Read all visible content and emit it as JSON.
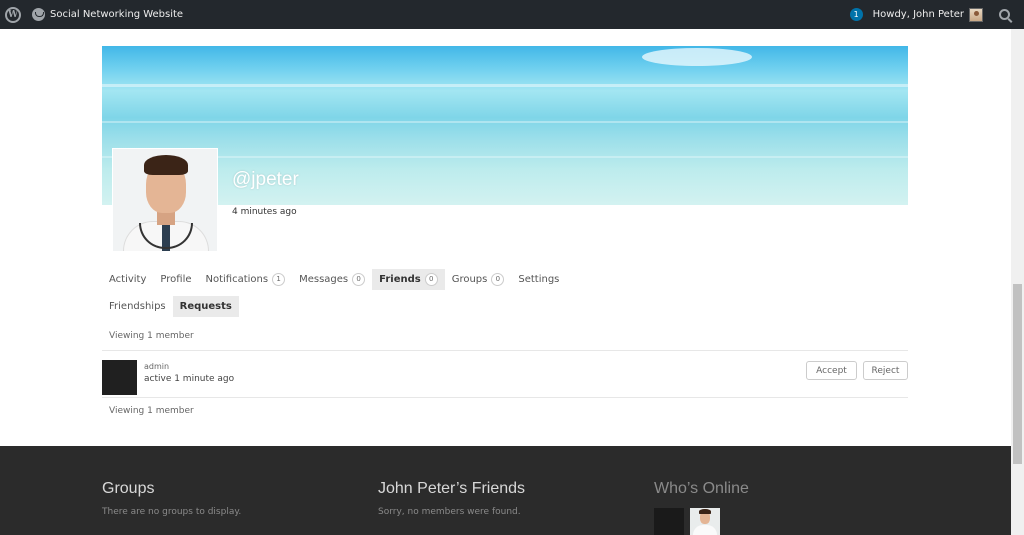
{
  "adminbar": {
    "site_name": "Social Networking Website",
    "notification_count": "1",
    "howdy": "Howdy, John Peter",
    "icons": [
      "wordpress-icon",
      "site-icon",
      "avatar",
      "search-icon"
    ]
  },
  "profile": {
    "username": "@jpeter",
    "last_active": "4 minutes ago"
  },
  "nav": {
    "items": [
      {
        "label": "Activity",
        "count": null
      },
      {
        "label": "Profile",
        "count": null
      },
      {
        "label": "Notifications",
        "count": "1"
      },
      {
        "label": "Messages",
        "count": "0"
      },
      {
        "label": "Friends",
        "count": "0",
        "active": true
      },
      {
        "label": "Groups",
        "count": "0"
      },
      {
        "label": "Settings",
        "count": null
      }
    ]
  },
  "subnav": {
    "items": [
      {
        "label": "Friendships"
      },
      {
        "label": "Requests",
        "active": true
      }
    ]
  },
  "list": {
    "viewing_top": "Viewing 1 member",
    "viewing_bottom": "Viewing 1 member",
    "members": [
      {
        "name": "admin",
        "status": "active 1 minute ago",
        "accept_label": "Accept",
        "reject_label": "Reject"
      }
    ]
  },
  "footer": {
    "groups_title": "Groups",
    "groups_text": "There are no groups to display.",
    "friends_title": "John Peter’s Friends",
    "friends_text": "Sorry, no members were found.",
    "online_title": "Who’s Online"
  },
  "colors": {
    "adminbar_bg": "#23282d",
    "footer_bg": "#2b2b2b",
    "notification_badge": "#0073aa"
  }
}
